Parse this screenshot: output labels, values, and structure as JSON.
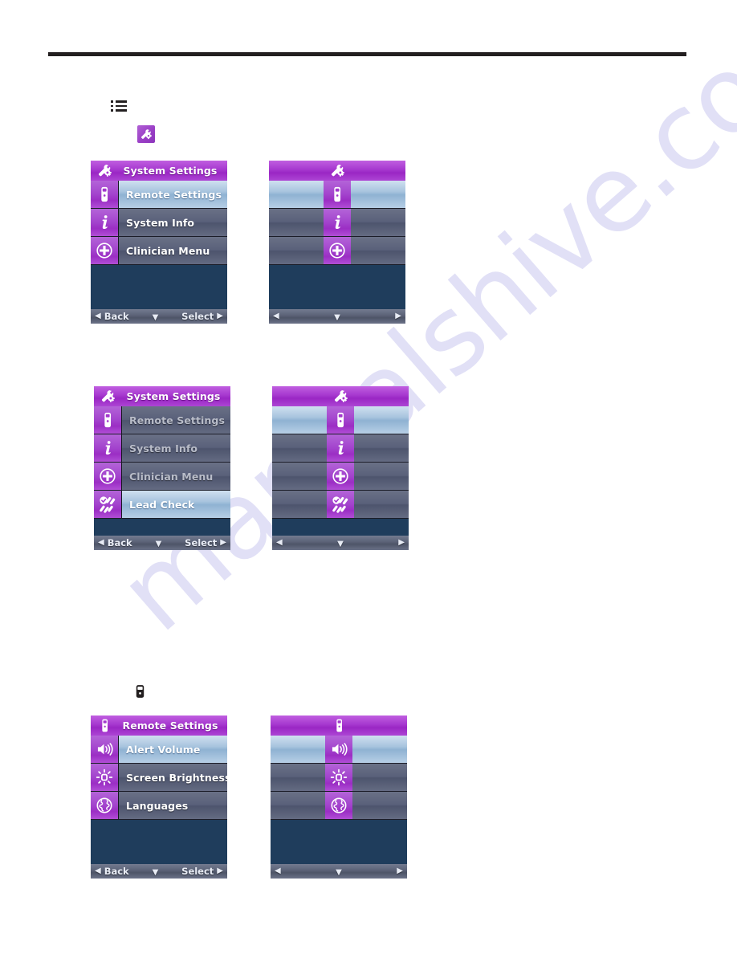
{
  "page": {
    "watermark": "manualshive.com",
    "rule": true
  },
  "inline_icons": [
    {
      "name": "list-icon",
      "label": "bullet-list"
    },
    {
      "name": "system-settings-chip-icon",
      "label": "System Settings"
    },
    {
      "name": "remote-settings-chip-icon",
      "label": "Remote Settings"
    }
  ],
  "footer": {
    "back_label": "Back",
    "select_label": "Select",
    "left_arrow": "◀",
    "right_arrow": "▶",
    "down_arrow": "▼"
  },
  "screens": [
    {
      "id": "system-settings-labeled",
      "variant": "labeled",
      "title": "System Settings",
      "header_icon": "system-settings-icon",
      "rows": [
        {
          "label": "Remote Settings",
          "icon": "remote-icon",
          "state": "selected"
        },
        {
          "label": "System Info",
          "icon": "info-icon",
          "state": "normal"
        },
        {
          "label": "Clinician Menu",
          "icon": "plus-circle-icon",
          "state": "normal"
        }
      ]
    },
    {
      "id": "system-settings-iconic",
      "variant": "iconic",
      "title": "",
      "header_icon": "system-settings-icon",
      "rows": [
        {
          "label": "",
          "icon": "remote-icon",
          "state": "selected"
        },
        {
          "label": "",
          "icon": "info-icon",
          "state": "normal"
        },
        {
          "label": "",
          "icon": "plus-circle-icon",
          "state": "normal"
        }
      ]
    },
    {
      "id": "system-settings-leadcheck-labeled",
      "variant": "labeled",
      "title": "System Settings",
      "header_icon": "system-settings-icon",
      "rows": [
        {
          "label": "Remote Settings",
          "icon": "remote-icon",
          "state": "normal"
        },
        {
          "label": "System Info",
          "icon": "info-icon",
          "state": "normal"
        },
        {
          "label": "Clinician Menu",
          "icon": "plus-circle-icon",
          "state": "normal"
        },
        {
          "label": "Lead Check",
          "icon": "lead-check-icon",
          "state": "selected"
        }
      ]
    },
    {
      "id": "system-settings-leadcheck-iconic",
      "variant": "iconic",
      "title": "",
      "header_icon": "system-settings-icon",
      "rows": [
        {
          "label": "",
          "icon": "remote-icon",
          "state": "selected"
        },
        {
          "label": "",
          "icon": "info-icon",
          "state": "normal"
        },
        {
          "label": "",
          "icon": "plus-circle-icon",
          "state": "normal"
        },
        {
          "label": "",
          "icon": "lead-check-icon",
          "state": "normal"
        }
      ]
    },
    {
      "id": "remote-settings-labeled",
      "variant": "labeled",
      "title": "Remote Settings",
      "header_icon": "remote-icon",
      "rows": [
        {
          "label": "Alert Volume",
          "icon": "volume-icon",
          "state": "selected"
        },
        {
          "label": "Screen Brightness",
          "icon": "brightness-icon",
          "state": "normal"
        },
        {
          "label": "Languages",
          "icon": "globe-icon",
          "state": "normal"
        }
      ]
    },
    {
      "id": "remote-settings-iconic",
      "variant": "iconic",
      "title": "",
      "header_icon": "remote-icon",
      "rows": [
        {
          "label": "",
          "icon": "volume-icon",
          "state": "selected"
        },
        {
          "label": "",
          "icon": "brightness-icon",
          "state": "normal"
        },
        {
          "label": "",
          "icon": "globe-icon",
          "state": "normal"
        }
      ]
    }
  ],
  "colors": {
    "accent_purple": "#a338cd",
    "panel_slate": "#59607a",
    "selected_blue": "#a8c4de",
    "fill_navy": "#1f3d5c",
    "rule_black": "#231f20",
    "watermark": "#c9c8ef"
  }
}
